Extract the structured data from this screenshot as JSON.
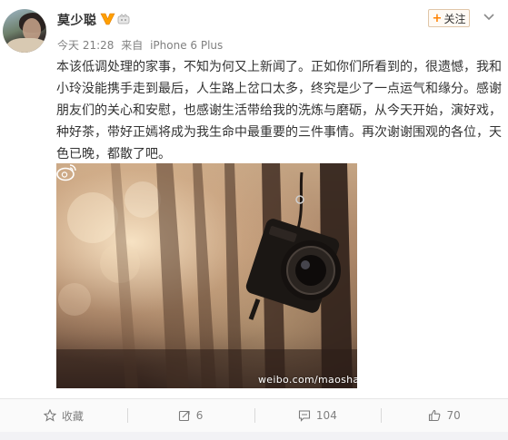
{
  "post": {
    "username": "莫少聪",
    "meta": {
      "time": "今天 21:28",
      "source_prefix": "来自",
      "source": "iPhone 6 Plus"
    },
    "follow_label": "关注",
    "content_lines": [
      "本该低调处理的家事，不知为何又上新闻了。正如你们所看到的，很遗憾，我和",
      "小玲没能携手走到最后，人生路上岔口太多，终究是少了一点运气和缘分。感谢",
      "朋友们的关心和安慰，也感谢生活带给我的洗炼与磨砺，从今天开始，演好戏，",
      "种好茶，带好正嫣将成为我生命中最重要的三件事情。再次谢谢围观的各位，天",
      "色已晚，都散了吧。"
    ],
    "image": {
      "watermark": "weibo.com/maosha"
    }
  },
  "actions": {
    "favorite_label": "收藏",
    "repost_count": "6",
    "comment_count": "104",
    "like_count": "70"
  },
  "colors": {
    "accent": "#ff8200",
    "text": "#333333",
    "meta": "#808080"
  },
  "icons": [
    "vip-icon",
    "club-icon",
    "menu-chevron-icon",
    "star-icon",
    "repost-icon",
    "comment-icon",
    "like-icon",
    "weibo-logo-icon"
  ]
}
